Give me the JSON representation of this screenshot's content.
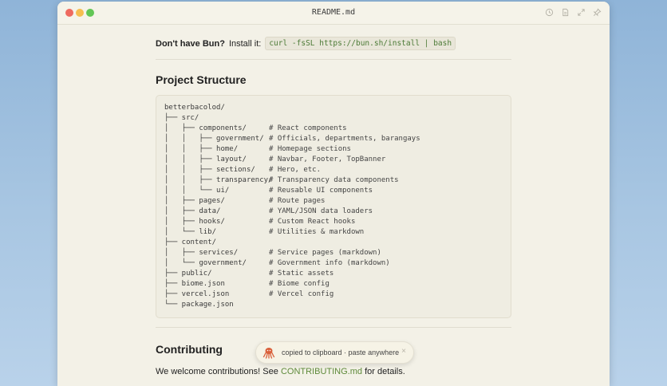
{
  "window": {
    "title": "README.md",
    "toolbar_icons": [
      "history-icon",
      "document-icon",
      "expand-icon",
      "pin-icon"
    ]
  },
  "install": {
    "prompt": "Don't have Bun?",
    "text": "Install it:",
    "command": "curl -fsSL https://bun.sh/install | bash"
  },
  "project_structure": {
    "heading": "Project Structure",
    "tree": [
      {
        "path": "betterbacolod/",
        "comment": ""
      },
      {
        "path": "├── src/",
        "comment": ""
      },
      {
        "path": "│   ├── components/",
        "comment": "# React components"
      },
      {
        "path": "│   │   ├── government/",
        "comment": "# Officials, departments, barangays"
      },
      {
        "path": "│   │   ├── home/",
        "comment": "# Homepage sections"
      },
      {
        "path": "│   │   ├── layout/",
        "comment": "# Navbar, Footer, TopBanner"
      },
      {
        "path": "│   │   ├── sections/",
        "comment": "# Hero, etc."
      },
      {
        "path": "│   │   ├── transparency/",
        "comment": "# Transparency data components"
      },
      {
        "path": "│   │   └── ui/",
        "comment": "# Reusable UI components"
      },
      {
        "path": "│   ├── pages/",
        "comment": "# Route pages"
      },
      {
        "path": "│   ├── data/",
        "comment": "# YAML/JSON data loaders"
      },
      {
        "path": "│   ├── hooks/",
        "comment": "# Custom React hooks"
      },
      {
        "path": "│   └── lib/",
        "comment": "# Utilities & markdown"
      },
      {
        "path": "├── content/",
        "comment": ""
      },
      {
        "path": "│   ├── services/",
        "comment": "# Service pages (markdown)"
      },
      {
        "path": "│   └── government/",
        "comment": "# Government info (markdown)"
      },
      {
        "path": "├── public/",
        "comment": "# Static assets"
      },
      {
        "path": "├── biome.json",
        "comment": "# Biome config"
      },
      {
        "path": "├── vercel.json",
        "comment": "# Vercel config"
      },
      {
        "path": "└── package.json",
        "comment": ""
      }
    ]
  },
  "contributing": {
    "heading": "Contributing",
    "text_before": "We welcome contributions! See",
    "link": "CONTRIBUTING.md",
    "text_after": "for details."
  },
  "toast": {
    "icon": "octopus-icon",
    "message": "copied to clipboard · paste anywhere",
    "close": "×"
  },
  "colors": {
    "page_bg": "#f3f1e7",
    "code_text": "#4b7a35",
    "link": "#5e8a3a",
    "traffic_close": "#ee6a5f",
    "traffic_min": "#f5be4f",
    "traffic_max": "#62c655"
  }
}
